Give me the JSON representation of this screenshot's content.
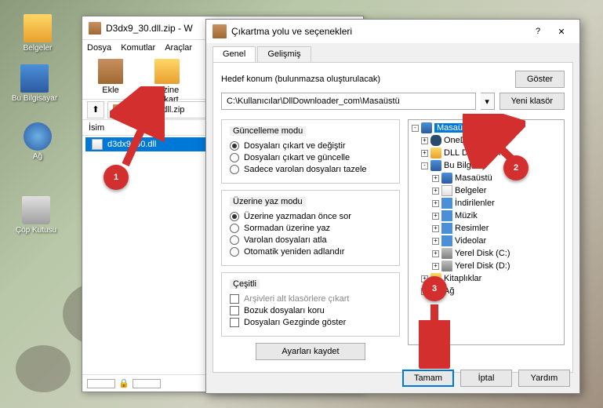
{
  "desktop": {
    "icons": [
      {
        "label": "Belgeler"
      },
      {
        "label": "Bu Bilgisayar"
      },
      {
        "label": "Ağ"
      },
      {
        "label": "Çöp Kutusu"
      }
    ]
  },
  "winrar": {
    "title": "D3dx9_30.dll.zip - W",
    "menu": [
      "Dosya",
      "Komutlar",
      "Araçlar"
    ],
    "toolbar": [
      {
        "label": "Ekle"
      },
      {
        "label": "Dizine Çıkart"
      }
    ],
    "path_file": "3dx9_30.dll.zip",
    "list_header": "İsim",
    "file": "d3dx9_30.dll"
  },
  "dialog": {
    "title": "Çıkartma yolu ve seçenekleri",
    "help_char": "?",
    "close_char": "✕",
    "tabs": [
      "Genel",
      "Gelişmiş"
    ],
    "dest_label": "Hedef konum (bulunmazsa oluşturulacak)",
    "dest_path": "C:\\Kullanıcılar\\DllDownloader_com\\Masaüstü",
    "btn_show": "Göster",
    "btn_newfolder": "Yeni klasör",
    "update_mode": {
      "title": "Güncelleme modu",
      "opts": [
        "Dosyaları çıkart ve değiştir",
        "Dosyaları çıkart ve güncelle",
        "Sadece varolan dosyaları tazele"
      ],
      "selected": 0
    },
    "overwrite_mode": {
      "title": "Üzerine yaz modu",
      "opts": [
        "Üzerine yazmadan önce sor",
        "Sormadan üzerine yaz",
        "Varolan dosyaları atla",
        "Otomatik yeniden adlandır"
      ],
      "selected": 0
    },
    "misc": {
      "title": "Çeşitli",
      "opts": [
        "Arşivleri alt klasörlere çıkart",
        "Bozuk dosyaları koru",
        "Dosyaları Gezginde göster"
      ]
    },
    "btn_save_settings": "Ayarları kaydet",
    "tree": [
      {
        "label": "Masaüstü",
        "depth": 0,
        "exp": "-",
        "icon": "i-pc",
        "selected": true
      },
      {
        "label": "OneD",
        "depth": 1,
        "exp": "+",
        "icon": "i-cloud"
      },
      {
        "label": "DLL Downloader.com",
        "depth": 1,
        "exp": "+",
        "icon": "i-folder",
        "truncated": "DLL D       ader.com"
      },
      {
        "label": "Bu Bilgisayar",
        "depth": 1,
        "exp": "-",
        "icon": "i-pc",
        "truncated": "Bu Bilgisay"
      },
      {
        "label": "Masaüstü",
        "depth": 2,
        "exp": "+",
        "icon": "i-pc"
      },
      {
        "label": "Belgeler",
        "depth": 2,
        "exp": "+",
        "icon": "i-file"
      },
      {
        "label": "İndirilenler",
        "depth": 2,
        "exp": "+",
        "icon": "i-dl"
      },
      {
        "label": "Müzik",
        "depth": 2,
        "exp": "+",
        "icon": "i-music"
      },
      {
        "label": "Resimler",
        "depth": 2,
        "exp": "+",
        "icon": "i-pic"
      },
      {
        "label": "Videolar",
        "depth": 2,
        "exp": "+",
        "icon": "i-vid"
      },
      {
        "label": "Yerel Disk (C:)",
        "depth": 2,
        "exp": "+",
        "icon": "i-disk"
      },
      {
        "label": "Yerel Disk (D:)",
        "depth": 2,
        "exp": "+",
        "icon": "i-disk"
      },
      {
        "label": "Kitaplıklar",
        "depth": 1,
        "exp": "+",
        "icon": "i-folder"
      },
      {
        "label": "Ağ",
        "depth": 1,
        "exp": "+",
        "icon": "i-net"
      }
    ],
    "btn_ok": "Tamam",
    "btn_cancel": "İptal",
    "btn_help": "Yardım"
  },
  "annotations": {
    "1": "1",
    "2": "2",
    "3": "3"
  }
}
